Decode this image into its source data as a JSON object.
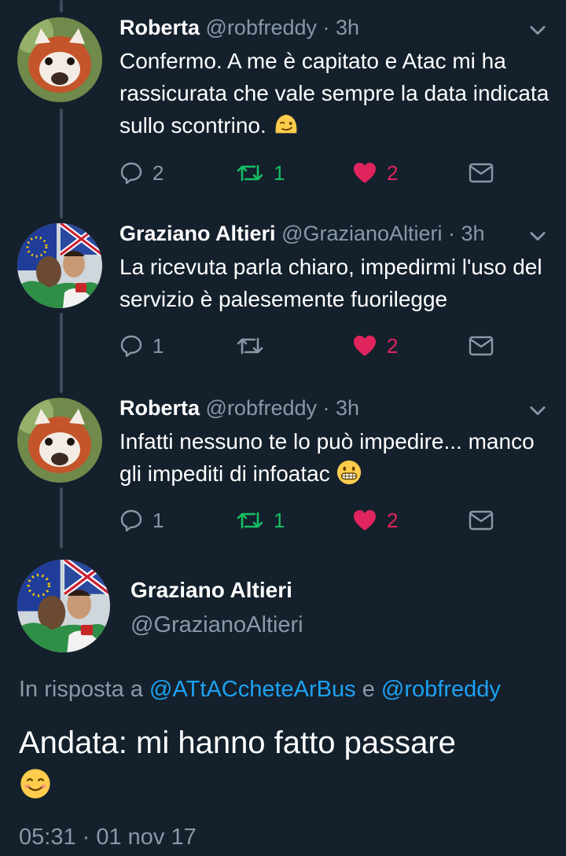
{
  "tweets": [
    {
      "name": "Roberta",
      "meta": "@robfreddy · 3h",
      "text": "Confermo. A me è capitato e Atac mi ha rassicurata che vale sempre la data indicata sullo scontrino.",
      "emoji": "wink-emoji",
      "replies": "2",
      "retweets": "1",
      "likes": "2"
    },
    {
      "name": "Graziano Altieri",
      "meta": "@GrazianoAltieri · 3h",
      "text": "La ricevuta parla chiaro, impedirmi l'uso del servizio è palesemente fuorilegge",
      "replies": "1",
      "retweets": "",
      "likes": "2"
    },
    {
      "name": "Roberta",
      "meta": "@robfreddy · 3h",
      "text": "Infatti nessuno te lo può impedire... manco gli impediti di infoatac",
      "emoji": "grin-emoji",
      "replies": "1",
      "retweets": "1",
      "likes": "2"
    }
  ],
  "main_tweet": {
    "name": "Graziano Altieri",
    "handle": "@GrazianoAltieri",
    "reply_prefix": "In risposta a",
    "reply_mention_1": "@ATtACcheteArBus",
    "reply_joiner": "e",
    "reply_mention_2": "@robfreddy",
    "text": "Andata: mi hanno fatto passare",
    "emoji": "smile-emoji",
    "timestamp": "05:31 · 01 nov 17"
  },
  "colors": {
    "background": "#14202c",
    "secondary_text": "#8899a6",
    "link": "#1da1f2",
    "retweet": "#17bf63",
    "like": "#e0245e"
  }
}
